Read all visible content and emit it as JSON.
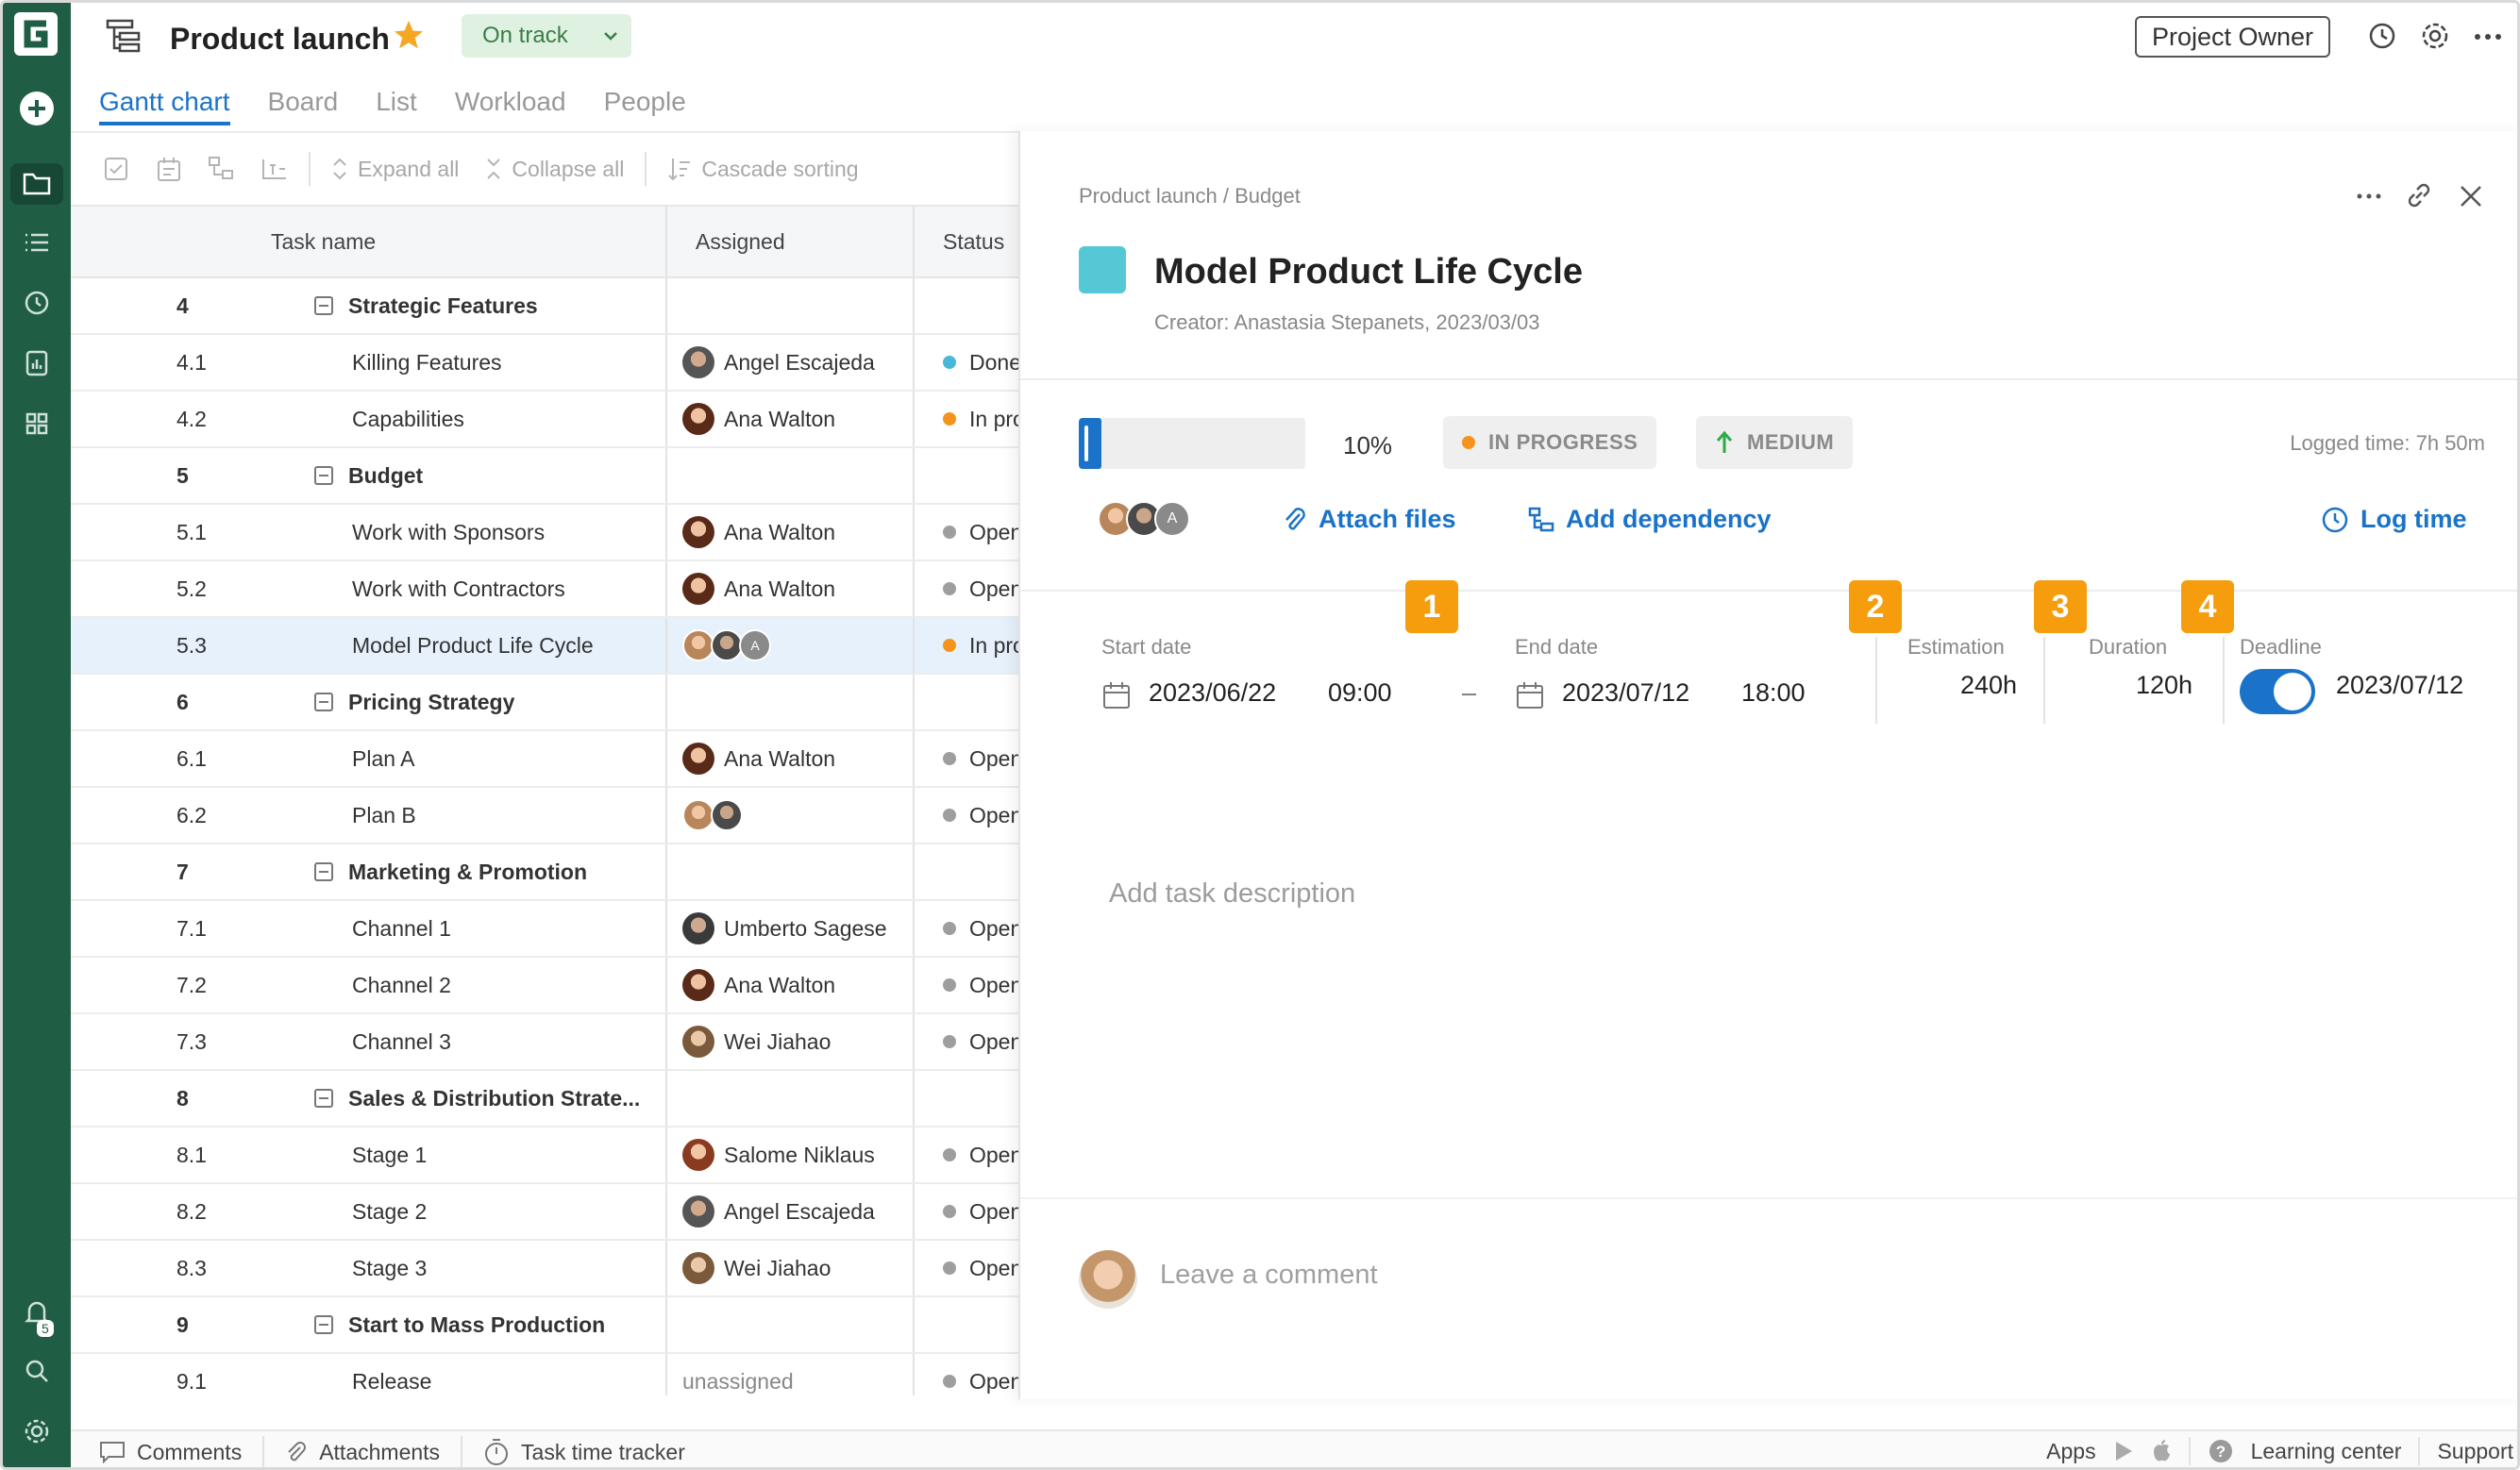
{
  "app": {
    "project_title": "Product launch",
    "project_status": "On track",
    "role_button": "Project Owner"
  },
  "tabs": [
    {
      "label": "Gantt chart",
      "active": true
    },
    {
      "label": "Board",
      "active": false
    },
    {
      "label": "List",
      "active": false
    },
    {
      "label": "Workload",
      "active": false
    },
    {
      "label": "People",
      "active": false
    }
  ],
  "toolbar": {
    "expand_all": "Expand all",
    "collapse_all": "Collapse all",
    "cascade_sorting": "Cascade sorting"
  },
  "grid": {
    "headers": {
      "task": "Task name",
      "assigned": "Assigned",
      "status": "Status"
    },
    "rows": [
      {
        "num": "4",
        "name": "Strategic Features",
        "group": true
      },
      {
        "num": "4.1",
        "name": "Killing Features",
        "assigned": "Angel Escajeda",
        "status": "Done",
        "status_color": "#47b9d8"
      },
      {
        "num": "4.2",
        "name": "Capabilities",
        "assigned": "Ana Walton",
        "status": "In progress",
        "status_color": "#f5941d"
      },
      {
        "num": "5",
        "name": "Budget",
        "group": true
      },
      {
        "num": "5.1",
        "name": "Work with Sponsors",
        "assigned": "Ana Walton",
        "status": "Open",
        "status_color": "#9e9e9e"
      },
      {
        "num": "5.2",
        "name": "Work with Contractors",
        "assigned": "Ana Walton",
        "status": "Open",
        "status_color": "#9e9e9e"
      },
      {
        "num": "5.3",
        "name": "Model Product Life Cycle",
        "assigned": "",
        "multi": 3,
        "status": "In progress",
        "status_color": "#f5941d",
        "selected": true
      },
      {
        "num": "6",
        "name": "Pricing Strategy",
        "group": true
      },
      {
        "num": "6.1",
        "name": "Plan A",
        "assigned": "Ana Walton",
        "status": "Open",
        "status_color": "#9e9e9e"
      },
      {
        "num": "6.2",
        "name": "Plan B",
        "assigned": "",
        "multi": 2,
        "status": "Open",
        "status_color": "#9e9e9e"
      },
      {
        "num": "7",
        "name": "Marketing & Promotion",
        "group": true
      },
      {
        "num": "7.1",
        "name": "Channel 1",
        "assigned": "Umberto Sagese",
        "status": "Open",
        "status_color": "#9e9e9e"
      },
      {
        "num": "7.2",
        "name": "Channel 2",
        "assigned": "Ana Walton",
        "status": "Open",
        "status_color": "#9e9e9e"
      },
      {
        "num": "7.3",
        "name": "Channel 3",
        "assigned": "Wei Jiahao",
        "status": "Open",
        "status_color": "#9e9e9e"
      },
      {
        "num": "8",
        "name": "Sales & Distribution Strate...",
        "group": true
      },
      {
        "num": "8.1",
        "name": "Stage 1",
        "assigned": "Salome Niklaus",
        "status": "Open",
        "status_color": "#9e9e9e"
      },
      {
        "num": "8.2",
        "name": "Stage 2",
        "assigned": "Angel Escajeda",
        "status": "Open",
        "status_color": "#9e9e9e"
      },
      {
        "num": "8.3",
        "name": "Stage 3",
        "assigned": "Wei Jiahao",
        "status": "Open",
        "status_color": "#9e9e9e"
      },
      {
        "num": "9",
        "name": "Start to Mass Production",
        "group": true
      },
      {
        "num": "9.1",
        "name": "Release",
        "assigned": "unassigned",
        "unassigned": true,
        "status": "Open",
        "status_color": "#9e9e9e"
      }
    ]
  },
  "panel": {
    "breadcrumb": "Product launch / Budget",
    "title": "Model Product Life Cycle",
    "creator": "Creator: Anastasia Stepanets, 2023/03/03",
    "progress_fraction": 0.1,
    "progress_label": "10%",
    "status": "IN PROGRESS",
    "priority": "MEDIUM",
    "logged_time": "Logged time: 7h 50m",
    "attach_files": "Attach files",
    "add_dependency": "Add dependency",
    "log_time": "Log time",
    "avatar_letter": "A",
    "badges": [
      "1",
      "2",
      "3",
      "4"
    ],
    "start_label": "Start date",
    "start_date": "2023/06/22",
    "start_time": "09:00",
    "dash": "–",
    "end_label": "End date",
    "end_date": "2023/07/12",
    "end_time": "18:00",
    "estimation_label": "Estimation",
    "estimation": "240h",
    "duration_label": "Duration",
    "duration": "120h",
    "deadline_label": "Deadline",
    "deadline_on": true,
    "deadline": "2023/07/12",
    "description_placeholder": "Add task description",
    "comment_placeholder": "Leave a comment"
  },
  "bottombar": {
    "comments": "Comments",
    "attachments": "Attachments",
    "time_tracker": "Task time tracker",
    "apps": "Apps",
    "learning": "Learning center",
    "support": "Support"
  },
  "notifications_count": "5",
  "colors": {
    "rail": "#1f5d45",
    "accent": "#1a73c8",
    "badge": "#f59d0d",
    "task_color": "#54c8d4",
    "in_progress": "#f5941d",
    "done": "#47b9d8"
  }
}
